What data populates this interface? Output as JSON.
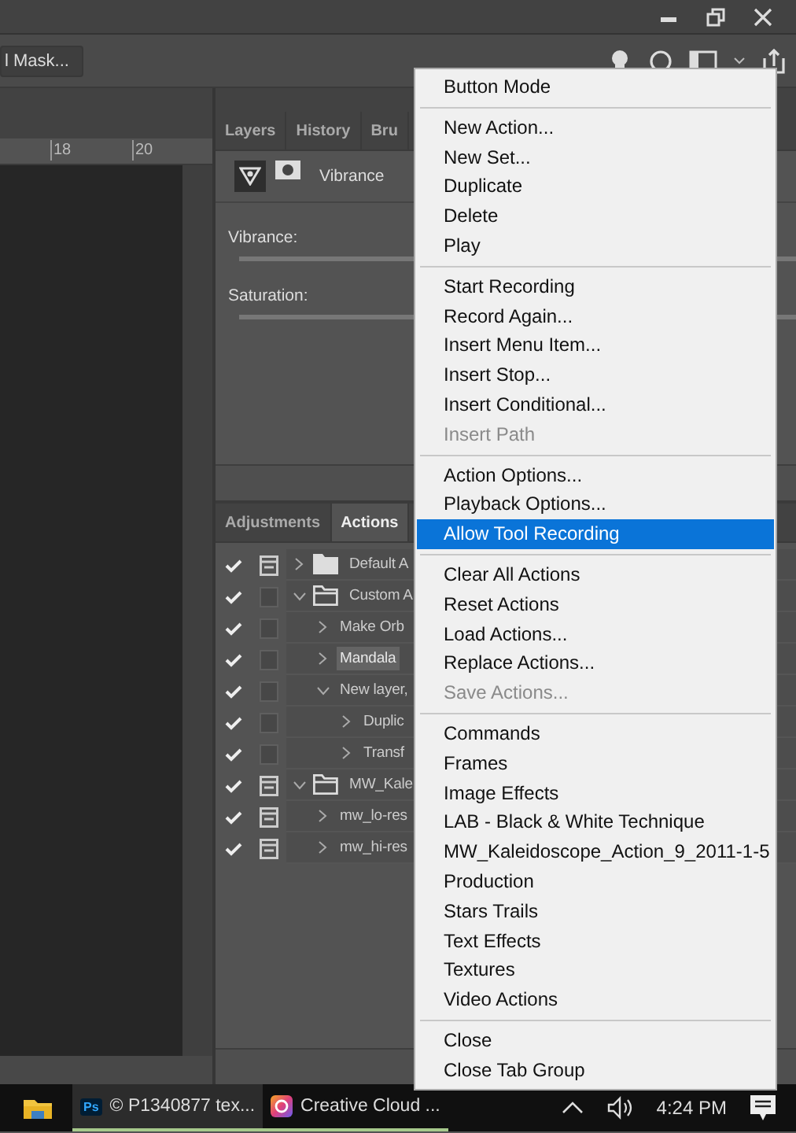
{
  "options_bar": {
    "button": "l Mask..."
  },
  "ruler": {
    "ticks": [
      "18",
      "20"
    ]
  },
  "panel_top": {
    "tabs": [
      {
        "label": "Layers",
        "selected": false
      },
      {
        "label": "History",
        "selected": false
      },
      {
        "label": "Bru",
        "selected": false
      }
    ],
    "properties": {
      "title": "Vibrance",
      "sliders": [
        {
          "label": "Vibrance:"
        },
        {
          "label": "Saturation:"
        }
      ]
    }
  },
  "panel_bottom": {
    "tabs": [
      {
        "label": "Adjustments",
        "selected": false
      },
      {
        "label": "Actions",
        "selected": true
      }
    ],
    "actions": [
      {
        "label": "Default A",
        "kind": "set",
        "checked": true,
        "dialog": true,
        "expanded": false,
        "selected": false
      },
      {
        "label": "Custom A",
        "kind": "set",
        "checked": true,
        "dialog": false,
        "expanded": true,
        "selected": false,
        "children": [
          {
            "label": "Make Orb",
            "kind": "action",
            "checked": true,
            "dialog": false,
            "expanded": false,
            "selected": false
          },
          {
            "label": "Mandala",
            "kind": "action",
            "checked": true,
            "dialog": false,
            "expanded": false,
            "selected": true
          },
          {
            "label": "New layer,",
            "kind": "action",
            "checked": true,
            "dialog": false,
            "expanded": true,
            "selected": false,
            "children": [
              {
                "label": "Duplic",
                "kind": "action",
                "checked": true,
                "dialog": false,
                "expanded": false,
                "selected": false
              },
              {
                "label": "Transf",
                "kind": "action",
                "checked": true,
                "dialog": false,
                "expanded": false,
                "selected": false
              }
            ]
          }
        ]
      },
      {
        "label": "MW_Kale",
        "kind": "set",
        "checked": true,
        "dialog": true,
        "expanded": true,
        "selected": false,
        "children": [
          {
            "label": "mw_lo-res",
            "kind": "action",
            "checked": true,
            "dialog": true,
            "expanded": false,
            "selected": false
          },
          {
            "label": "mw_hi-res",
            "kind": "action",
            "checked": true,
            "dialog": true,
            "expanded": false,
            "selected": false
          }
        ]
      }
    ]
  },
  "menu": {
    "groups": [
      {
        "items": [
          {
            "label": "Button Mode",
            "disabled": false,
            "selected": false
          }
        ]
      },
      {
        "items": [
          {
            "label": "New Action...",
            "disabled": false,
            "selected": false
          },
          {
            "label": "New Set...",
            "disabled": false,
            "selected": false
          },
          {
            "label": "Duplicate",
            "disabled": false,
            "selected": false
          },
          {
            "label": "Delete",
            "disabled": false,
            "selected": false
          },
          {
            "label": "Play",
            "disabled": false,
            "selected": false
          }
        ]
      },
      {
        "items": [
          {
            "label": "Start Recording",
            "disabled": false,
            "selected": false
          },
          {
            "label": "Record Again...",
            "disabled": false,
            "selected": false
          },
          {
            "label": "Insert Menu Item...",
            "disabled": false,
            "selected": false
          },
          {
            "label": "Insert Stop...",
            "disabled": false,
            "selected": false
          },
          {
            "label": "Insert Conditional...",
            "disabled": false,
            "selected": false
          },
          {
            "label": "Insert Path",
            "disabled": true,
            "selected": false
          }
        ]
      },
      {
        "items": [
          {
            "label": "Action Options...",
            "disabled": false,
            "selected": false
          },
          {
            "label": "Playback Options...",
            "disabled": false,
            "selected": false
          },
          {
            "label": "Allow Tool Recording",
            "disabled": false,
            "selected": true
          }
        ]
      },
      {
        "items": [
          {
            "label": "Clear All Actions",
            "disabled": false,
            "selected": false
          },
          {
            "label": "Reset Actions",
            "disabled": false,
            "selected": false
          },
          {
            "label": "Load Actions...",
            "disabled": false,
            "selected": false
          },
          {
            "label": "Replace Actions...",
            "disabled": false,
            "selected": false
          },
          {
            "label": "Save Actions...",
            "disabled": true,
            "selected": false
          }
        ]
      },
      {
        "items": [
          {
            "label": "Commands",
            "disabled": false,
            "selected": false
          },
          {
            "label": "Frames",
            "disabled": false,
            "selected": false
          },
          {
            "label": "Image Effects",
            "disabled": false,
            "selected": false
          },
          {
            "label": "LAB - Black & White Technique",
            "disabled": false,
            "selected": false
          },
          {
            "label": "MW_Kaleidoscope_Action_9_2011-1-5",
            "disabled": false,
            "selected": false
          },
          {
            "label": "Production",
            "disabled": false,
            "selected": false
          },
          {
            "label": "Stars Trails",
            "disabled": false,
            "selected": false
          },
          {
            "label": "Text Effects",
            "disabled": false,
            "selected": false
          },
          {
            "label": "Textures",
            "disabled": false,
            "selected": false
          },
          {
            "label": "Video Actions",
            "disabled": false,
            "selected": false
          }
        ]
      },
      {
        "items": [
          {
            "label": "Close",
            "disabled": false,
            "selected": false
          },
          {
            "label": "Close Tab Group",
            "disabled": false,
            "selected": false
          }
        ]
      }
    ]
  },
  "taskbar": {
    "apps": [
      {
        "kind": "photoshop",
        "badge": "Ps",
        "label": "© P1340877 tex...",
        "selected": true
      },
      {
        "kind": "creative-cloud",
        "label": "Creative Cloud ...",
        "selected": false
      }
    ],
    "clock": "4:24 PM"
  }
}
